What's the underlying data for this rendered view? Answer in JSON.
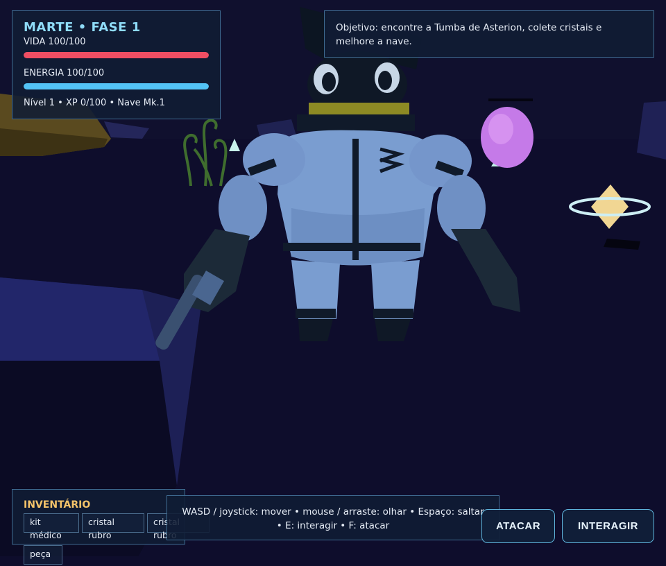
{
  "hud": {
    "title": "MARTE • FASE 1",
    "health_label": "VIDA 100/100",
    "health_fraction": 1.0,
    "energy_label": "ENERGIA 100/100",
    "energy_fraction": 1.0,
    "stats": "Nível 1 • XP 0/100 • Nave Mk.1"
  },
  "objective": {
    "text": "Objetivo: encontre a Tumba de Asterion, colete cristais e melhore a nave."
  },
  "inventory": {
    "title": "INVENTÁRIO",
    "items": [
      "kit médico",
      "cristal rubro",
      "cristal rubro",
      "peça"
    ]
  },
  "controls": {
    "text": "WASD / joystick: mover • mouse / arraste: olhar • Espaço: saltar • E: interagir • F: atacar"
  },
  "buttons": {
    "attack": "ATACAR",
    "interact": "INTERAGIR"
  },
  "colors": {
    "background": "#0e0d2c",
    "health": "#ef4e63",
    "energy": "#53c3f5",
    "title_accent": "#8fdcf8",
    "inventory_accent": "#f5c46a",
    "button_border": "#5fb4dc"
  },
  "scene": {
    "character": "astronaut-in-blue-spacesuit",
    "objects": [
      "rock-terrain",
      "curly-alien-plants",
      "crystal-shards",
      "purple-egg-pod",
      "ringed-yellow-crystal",
      "raised-dark-platform"
    ]
  }
}
